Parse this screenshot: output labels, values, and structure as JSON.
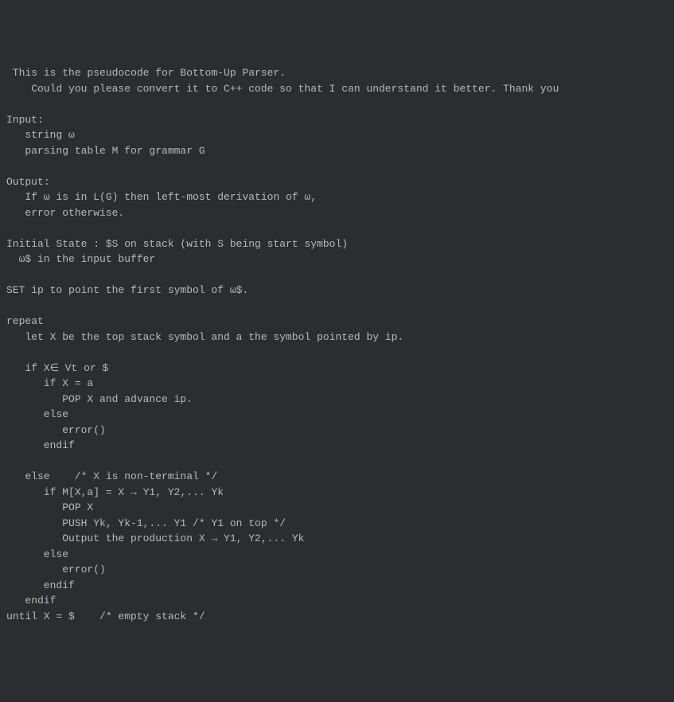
{
  "lines": [
    " This is the pseudocode for Bottom-Up Parser.",
    "    Could you please convert it to C++ code so that I can understand it better. Thank you",
    "",
    "Input:",
    "   string ω",
    "   parsing table M for grammar G",
    "",
    "Output:",
    "   If ω is in L(G) then left-most derivation of ω,",
    "   error otherwise.",
    "",
    "Initial State : $S on stack (with S being start symbol)",
    "  ω$ in the input buffer",
    "",
    "SET ip to point the first symbol of ω$.",
    "",
    "repeat",
    "   let X be the top stack symbol and a the symbol pointed by ip.",
    "",
    "   if X∈ Vt or $",
    "      if X = a",
    "         POP X and advance ip.",
    "      else",
    "         error()",
    "      endif",
    "",
    "   else    /* X is non-terminal */",
    "      if M[X,a] = X → Y1, Y2,... Yk",
    "         POP X",
    "         PUSH Yk, Yk-1,... Y1 /* Y1 on top */",
    "         Output the production X → Y1, Y2,... Yk",
    "      else",
    "         error()",
    "      endif",
    "   endif",
    "until X = $    /* empty stack */"
  ]
}
